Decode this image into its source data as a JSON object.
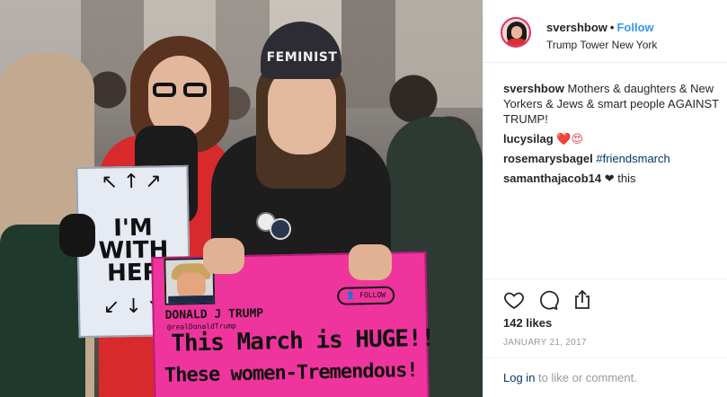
{
  "post": {
    "username": "svershbow",
    "follow_label": "Follow",
    "separator": "•",
    "location": "Trump Tower New York"
  },
  "photo": {
    "beanie_text": "FEMINIST",
    "sign_her": {
      "line1": "I'M",
      "line2": "WITH",
      "line3": "HER"
    },
    "sign_pink": {
      "name": "DONALD J TRUMP",
      "handle": "@realDonaldTrump",
      "follow": "FOLLOW",
      "line1": "This March is HUGE!!",
      "line2": "These women-Tremendous!"
    }
  },
  "comments": [
    {
      "user": "svershbow",
      "text": "Mothers & daughters & New Yorkers & Jews & smart people AGAINST TRUMP!"
    },
    {
      "user": "lucysilag",
      "text": "❤️😍"
    },
    {
      "user": "rosemarysbagel",
      "text": "#friendsmarch"
    },
    {
      "user": "samanthajacob14",
      "text": "❤ this"
    }
  ],
  "stats": {
    "likes": "142 likes",
    "date": "JANUARY 21, 2017"
  },
  "footer": {
    "login_link": "Log in",
    "login_text": " to like or comment."
  },
  "icons": {
    "like": "heart-outline-icon",
    "comment": "speech-bubble-icon",
    "share": "share-icon"
  },
  "colors": {
    "follow": "#3897f0",
    "link": "#003569",
    "muted": "#999999",
    "story_ring": "#e1306c",
    "pink_sign": "#f0349e"
  }
}
